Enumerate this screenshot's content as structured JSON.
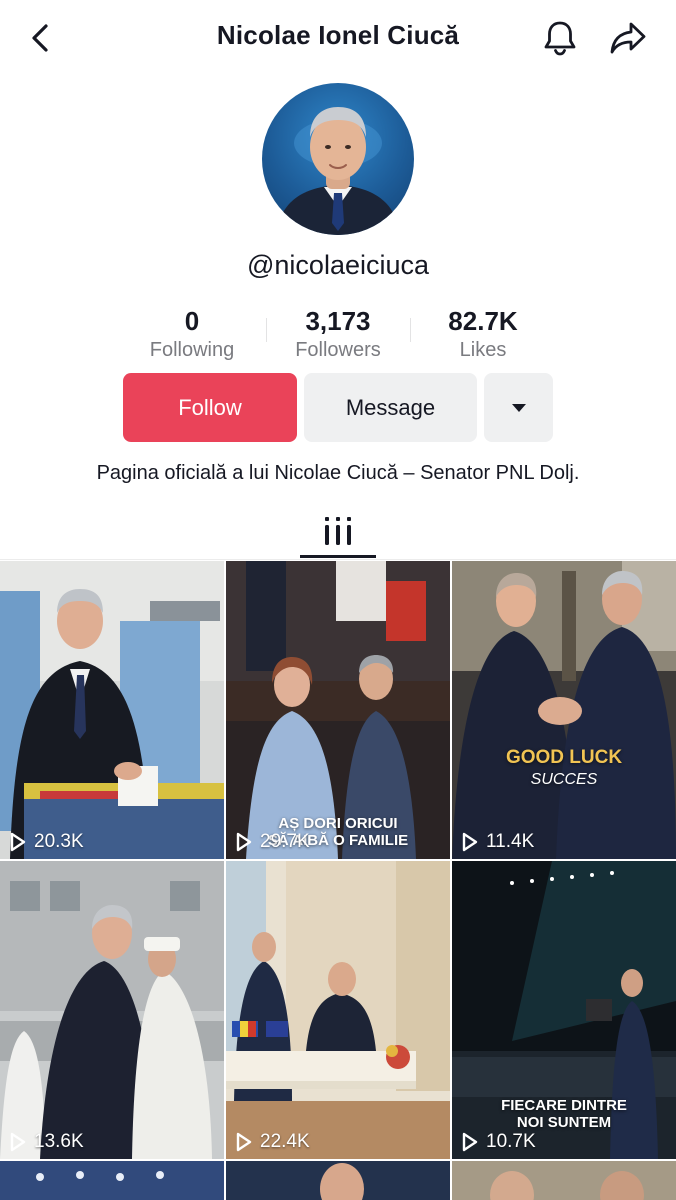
{
  "header": {
    "title": "Nicolae Ionel Ciucă"
  },
  "profile": {
    "username": "@nicolaeiciuca",
    "bio": "Pagina oficială a lui Nicolae Ciucă – Senator PNL Dolj."
  },
  "stats": [
    {
      "value": "0",
      "label": "Following"
    },
    {
      "value": "3,173",
      "label": "Followers"
    },
    {
      "value": "82.7K",
      "label": "Likes"
    }
  ],
  "actions": {
    "follow_label": "Follow",
    "message_label": "Message"
  },
  "colors": {
    "follow": "#ea4359",
    "secondary_button": "#eff0f1",
    "text": "#161823",
    "muted": "#7a7b80"
  },
  "videos": [
    {
      "views": "20.3K"
    },
    {
      "views": "29.7K",
      "caption_lines": [
        "AȘ DORI ORICUI",
        "SĂ AIBĂ O FAMILIE"
      ]
    },
    {
      "views": "11.4K",
      "caption_lines": [
        "GOOD LUCK",
        "SUCCES"
      ]
    },
    {
      "views": "13.6K"
    },
    {
      "views": "22.4K"
    },
    {
      "views": "10.7K",
      "caption_lines": [
        "FIECARE DINTRE",
        "NOI SUNTEM"
      ]
    }
  ]
}
